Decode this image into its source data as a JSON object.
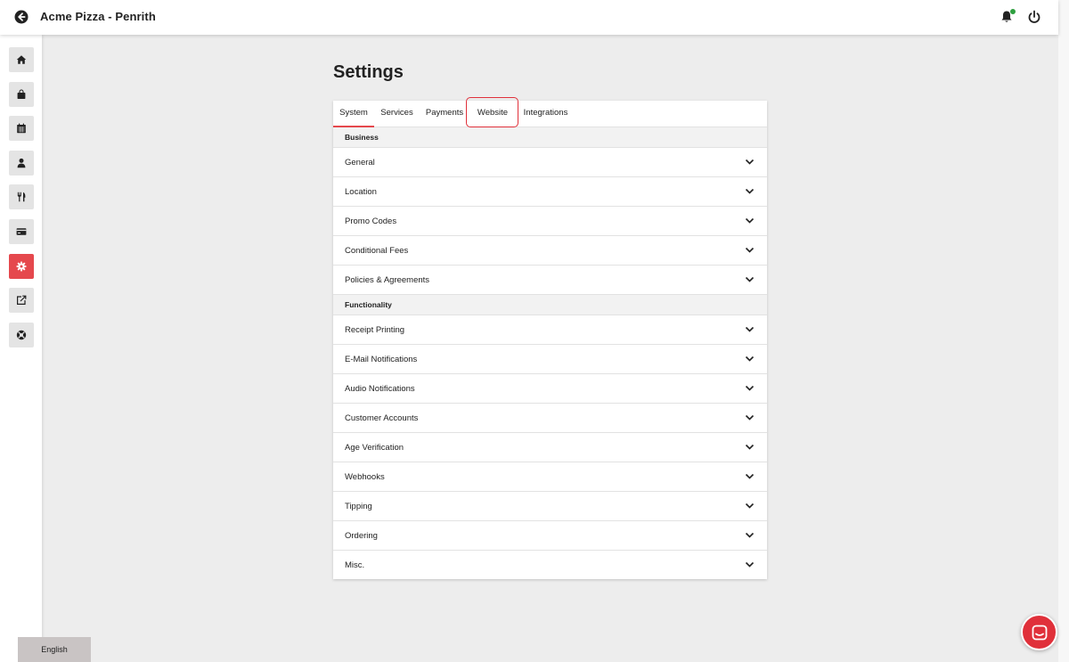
{
  "header": {
    "title": "Acme Pizza - Penrith",
    "back_icon": "arrow-left-circle-icon",
    "notification_icon": "bell-icon",
    "power_icon": "power-icon",
    "notification_dot_color": "#2e9f3f"
  },
  "sidebar": {
    "items": [
      {
        "name": "home",
        "icon": "home-icon",
        "active": false
      },
      {
        "name": "orders",
        "icon": "shopping-bag-icon",
        "active": false
      },
      {
        "name": "bookings",
        "icon": "calendar-icon",
        "active": false
      },
      {
        "name": "customers",
        "icon": "user-icon",
        "active": false
      },
      {
        "name": "menus",
        "icon": "utensils-icon",
        "active": false
      },
      {
        "name": "billing",
        "icon": "credit-card-icon",
        "active": false
      },
      {
        "name": "settings",
        "icon": "gear-icon",
        "active": true
      },
      {
        "name": "external",
        "icon": "external-link-icon",
        "active": false
      },
      {
        "name": "support",
        "icon": "lifebuoy-icon",
        "active": false
      }
    ],
    "active_color": "#e5484d"
  },
  "language": {
    "label": "English"
  },
  "main": {
    "title": "Settings",
    "tabs": [
      {
        "label": "System",
        "active": true
      },
      {
        "label": "Services",
        "active": false
      },
      {
        "label": "Payments",
        "active": false
      },
      {
        "label": "Website",
        "active": false,
        "highlighted": true
      },
      {
        "label": "Integrations",
        "active": false
      }
    ],
    "sections": [
      {
        "title": "Business",
        "items": [
          "General",
          "Location",
          "Promo Codes",
          "Conditional Fees",
          "Policies & Agreements"
        ]
      },
      {
        "title": "Functionality",
        "items": [
          "Receipt Printing",
          "E-Mail Notifications",
          "Audio Notifications",
          "Customer Accounts",
          "Age Verification",
          "Webhooks",
          "Tipping",
          "Ordering",
          "Misc."
        ]
      }
    ]
  },
  "chat": {
    "icon": "chat-icon",
    "color": "#e0303a"
  }
}
